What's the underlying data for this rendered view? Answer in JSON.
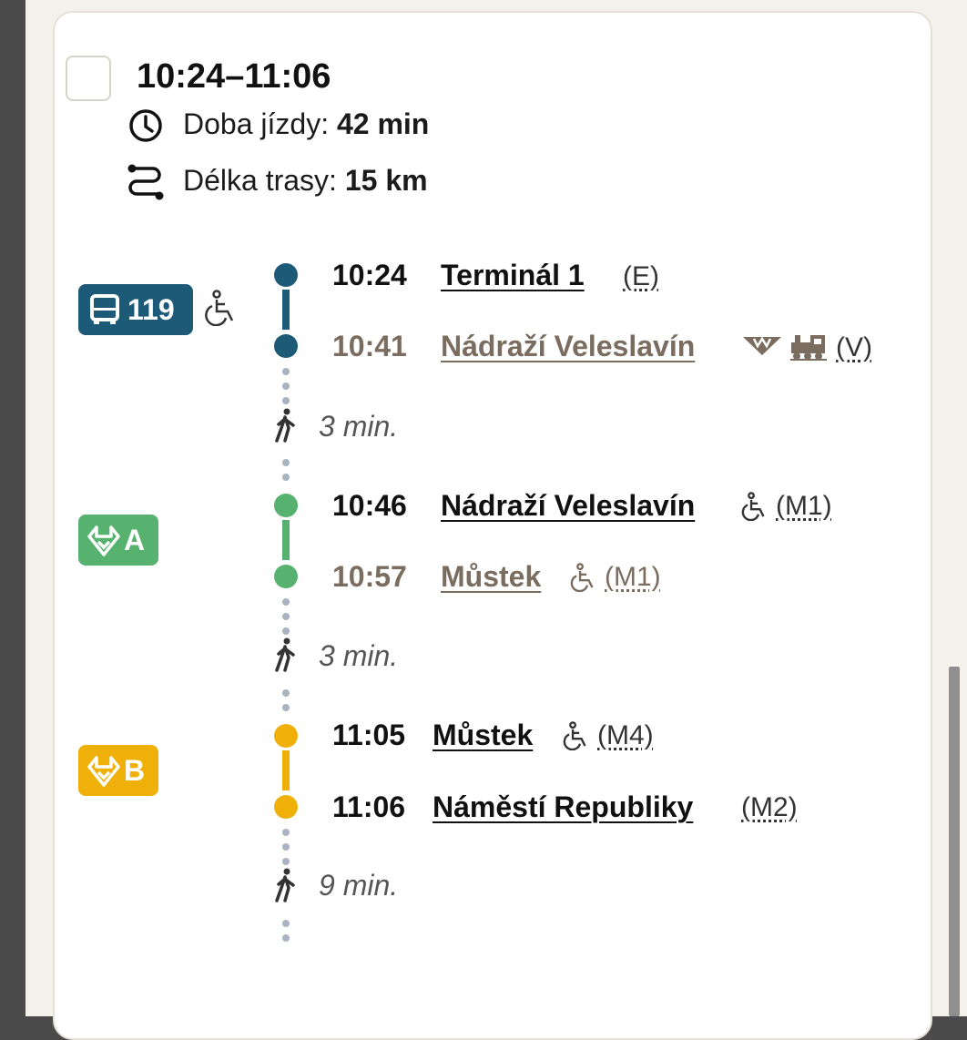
{
  "connection": {
    "time_range": "10:24–11:06",
    "duration_label": "Doba jízdy:",
    "duration_value": "42 min",
    "distance_label": "Délka trasy:",
    "distance_value": "15 km"
  },
  "legs": [
    {
      "line": "119",
      "icon": "bus-icon",
      "color": "#1d5a78",
      "accessible": true,
      "from": {
        "time": "10:24",
        "stop": "Terminál 1",
        "zone": "(E)"
      },
      "to": {
        "time": "10:41",
        "stop": "Nádraží Veleslavín",
        "zone": "(V)",
        "transfer_icons": [
          "metro-icon",
          "train-icon"
        ]
      }
    },
    {
      "line": "A",
      "icon": "metro-icon",
      "color": "#56b26e",
      "from": {
        "time": "10:46",
        "stop": "Nádraží Veleslavín",
        "zone": "(M1)",
        "accessible": true
      },
      "to": {
        "time": "10:57",
        "stop": "Můstek",
        "zone": "(M1)",
        "accessible": true
      }
    },
    {
      "line": "B",
      "icon": "metro-icon",
      "color": "#f0b00a",
      "from": {
        "time": "11:05",
        "stop": "Můstek",
        "zone": "(M4)",
        "accessible": true
      },
      "to": {
        "time": "11:06",
        "stop": "Náměstí Republiky",
        "zone": "(M2)"
      }
    }
  ],
  "walks": [
    {
      "duration": "3 min."
    },
    {
      "duration": "3 min."
    },
    {
      "duration": "9 min."
    }
  ],
  "colors": {
    "card_background": "#ffffff",
    "page_background": "#f4f1ea",
    "muted_text": "#7a6c5f",
    "walk_dot": "#a9b4c0"
  }
}
